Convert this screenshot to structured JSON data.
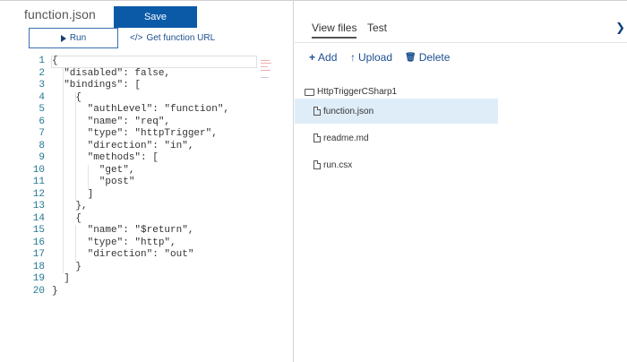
{
  "editor": {
    "file_title": "function.json",
    "save_label": "Save",
    "run_label": "Run",
    "get_url_label": "Get function URL",
    "get_url_icon": "</>",
    "lines": [
      {
        "n": "1",
        "text": "{"
      },
      {
        "n": "2",
        "text": "  \"disabled\": false,"
      },
      {
        "n": "3",
        "text": "  \"bindings\": ["
      },
      {
        "n": "4",
        "text": "    {"
      },
      {
        "n": "5",
        "text": "      \"authLevel\": \"function\","
      },
      {
        "n": "6",
        "text": "      \"name\": \"req\","
      },
      {
        "n": "7",
        "text": "      \"type\": \"httpTrigger\","
      },
      {
        "n": "8",
        "text": "      \"direction\": \"in\","
      },
      {
        "n": "9",
        "text": "      \"methods\": ["
      },
      {
        "n": "10",
        "text": "        \"get\","
      },
      {
        "n": "11",
        "text": "        \"post\""
      },
      {
        "n": "12",
        "text": "      ]"
      },
      {
        "n": "13",
        "text": "    },"
      },
      {
        "n": "14",
        "text": "    {"
      },
      {
        "n": "15",
        "text": "      \"name\": \"$return\","
      },
      {
        "n": "16",
        "text": "      \"type\": \"http\","
      },
      {
        "n": "17",
        "text": "      \"direction\": \"out\""
      },
      {
        "n": "18",
        "text": "    }"
      },
      {
        "n": "19",
        "text": "  ]"
      },
      {
        "n": "20",
        "text": "}"
      }
    ]
  },
  "files_panel": {
    "tabs": [
      {
        "label": "View files",
        "active": true
      },
      {
        "label": "Test",
        "active": false
      }
    ],
    "collapse_icon": "chevron-right-icon",
    "actions": {
      "add": {
        "icon": "+",
        "label": "Add"
      },
      "upload": {
        "icon": "↑",
        "label": "Upload"
      },
      "delete": {
        "icon": "🗑",
        "label": "Delete"
      }
    },
    "root_folder": "HttpTriggerCSharp1",
    "files": [
      {
        "name": "function.json",
        "selected": true
      },
      {
        "name": "readme.md",
        "selected": false
      },
      {
        "name": "run.csx",
        "selected": false
      }
    ]
  },
  "colors": {
    "accent": "#0b5aa8",
    "link": "#1b4f8f",
    "selected_row": "#dfedf9"
  }
}
